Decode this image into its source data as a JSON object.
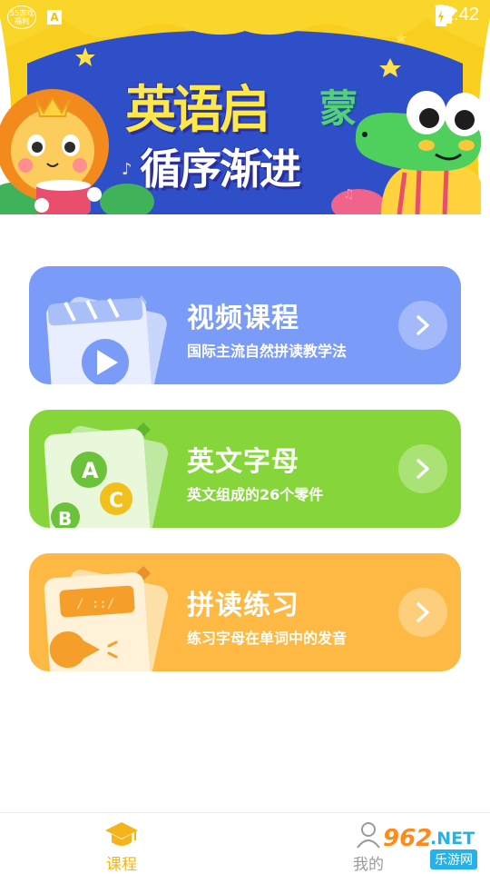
{
  "status_bar": {
    "left_badge_line1": "55游戏",
    "left_badge_line2": "福利",
    "app_icon_letter": "A",
    "time": "11:42"
  },
  "banner": {
    "title_line1": "英语启",
    "title_line1_accent": "蒙",
    "title_line2": "循序渐进"
  },
  "cards": [
    {
      "title": "视频课程",
      "subtitle": "国际主流自然拼读教学法",
      "color": "#7b9bf8"
    },
    {
      "title": "英文字母",
      "subtitle": "英文组成的26个零件",
      "color": "#86d63b"
    },
    {
      "title": "拼读练习",
      "subtitle": "练习字母在单词中的发音",
      "color": "#fdb943"
    }
  ],
  "card_art": {
    "letters": [
      "A",
      "C",
      "B"
    ],
    "screen_text": "/ ::/"
  },
  "bottom_nav": {
    "items": [
      {
        "label": "课程",
        "icon": "graduation-cap-icon",
        "active": true
      },
      {
        "label": "我的",
        "icon": "person-icon",
        "active": false
      }
    ],
    "active_color": "#f5b51a"
  },
  "watermark": {
    "brand": "962",
    "domain": ".NET",
    "sub": "乐游网"
  }
}
